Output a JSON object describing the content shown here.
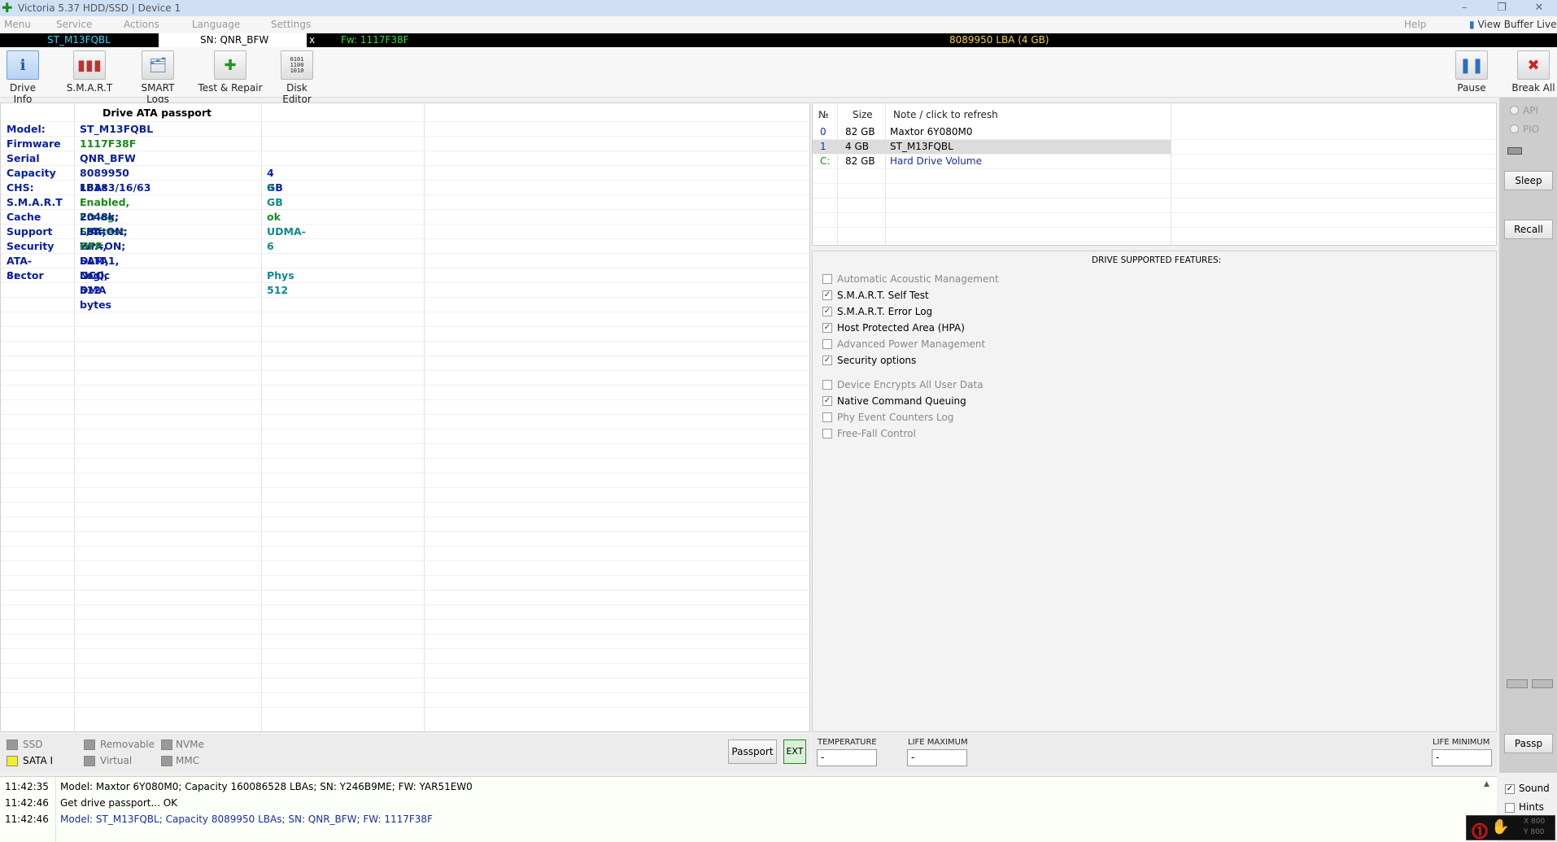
{
  "window": {
    "title": "Victoria 5.37 HDD/SSD | Device 1",
    "controls": [
      "–",
      "❐",
      "✕"
    ]
  },
  "menu": {
    "items": [
      "Menu",
      "Service",
      "Actions",
      "Language",
      "Settings"
    ],
    "help": "Help",
    "view_buffer": "View Buffer Live"
  },
  "strip": {
    "model": "ST_M13FQBL",
    "serial": "SN: QNR_BFW",
    "close": "x",
    "firmware": "Fw: 1117F38F",
    "capacity": "8089950 LBA (4 GB)"
  },
  "toolbar": {
    "drive_info": "Drive Info",
    "smart": "S.M.A.R.T",
    "smart_logs": "SMART Logs",
    "test_repair": "Test & Repair",
    "disk_editor": "Disk Editor",
    "pause": "Pause",
    "break_all": "Break All"
  },
  "passport": {
    "header": "Drive ATA passport",
    "rows": [
      {
        "label": "Model:",
        "value": "ST_M13FQBL",
        "extra": ""
      },
      {
        "label": "Firmware",
        "value": "1117F38F",
        "extra": ""
      },
      {
        "label": "Serial",
        "value": "QNR_BFW",
        "extra": ""
      },
      {
        "label": "Capacity",
        "value": "8089950 LBAs",
        "extra": "4 GB"
      },
      {
        "label": "CHS:",
        "value": "16383/16/63",
        "extra": "8 GB"
      },
      {
        "label": "S.M.A.R.T",
        "value": "Enabled, Errlog, Selftest",
        "extra": ""
      },
      {
        "label": "Cache",
        "value": "2048k; L/A=ON; Wr=ON;",
        "extra": "ok"
      },
      {
        "label": "Support",
        "value": "LBA, HPA, DLM, DCO, DMA",
        "extra": "UDMA-6"
      },
      {
        "label": "Security",
        "value": "OFF",
        "extra": ""
      },
      {
        "label": "ATA-8:",
        "value": "SATA1, NCQ",
        "extra": ""
      },
      {
        "label": "Sector",
        "value": "Logic 512 bytes",
        "extra": "Phys 512"
      }
    ]
  },
  "device_types": {
    "ssd": "SSD",
    "sata": "SATA I",
    "removable": "Removable",
    "virtual": "Virtual",
    "nvme": "NVMe",
    "mmc": "MMC"
  },
  "buttons": {
    "passport": "Passport",
    "ext": "EXT",
    "sleep": "Sleep",
    "recall": "Recall",
    "passp": "Passp"
  },
  "drives": {
    "headers": [
      "№",
      "Size",
      "Note / click to refresh"
    ],
    "rows": [
      {
        "num": "0",
        "size": "82 GB",
        "note": "Maxtor 6Y080M0"
      },
      {
        "num": "1",
        "size": "4 GB",
        "note": "ST_M13FQBL"
      },
      {
        "num": "C:",
        "size": "82 GB",
        "note": "Hard Drive Volume"
      }
    ]
  },
  "features": {
    "title": "DRIVE SUPPORTED FEATURES:",
    "items": [
      {
        "label": "Automatic Acoustic Management",
        "checked": false
      },
      {
        "label": "S.M.A.R.T. Self Test",
        "checked": true
      },
      {
        "label": "S.M.A.R.T. Error Log",
        "checked": true
      },
      {
        "label": "Host Protected Area (HPA)",
        "checked": true
      },
      {
        "label": "Advanced Power Management",
        "checked": false
      },
      {
        "label": "Security options",
        "checked": true
      },
      {
        "label": "Device Encrypts All User Data",
        "checked": false
      },
      {
        "label": "Native Command Queuing",
        "checked": true
      },
      {
        "label": "Phy Event Counters Log",
        "checked": false
      },
      {
        "label": "Free-Fall Control",
        "checked": false
      }
    ]
  },
  "metrics": {
    "temperature_label": "TEMPERATURE",
    "temperature": "-",
    "life_max_label": "LIFE MAXIMUM",
    "life_max": "-",
    "life_min_label": "LIFE MINIMUM",
    "life_min": "-"
  },
  "sidebar": {
    "api": "API",
    "pio": "PIO",
    "sound": "Sound",
    "hints": "Hints",
    "x": "X 800",
    "y": "Y 800"
  },
  "log": [
    {
      "time": "11:42:35",
      "text": "Model: Maxtor 6Y080M0; Capacity 160086528 LBAs; SN: Y246B9ME; FW: YAR51EW0",
      "color": "#000000"
    },
    {
      "time": "11:42:46",
      "text": "Get drive passport... OK",
      "color": "#000000"
    },
    {
      "time": "11:42:46",
      "text": "Model: ST_M13FQBL; Capacity 8089950 LBAs; SN: QNR_BFW; FW: 1117F38F",
      "color": "#1a2ea0"
    }
  ]
}
